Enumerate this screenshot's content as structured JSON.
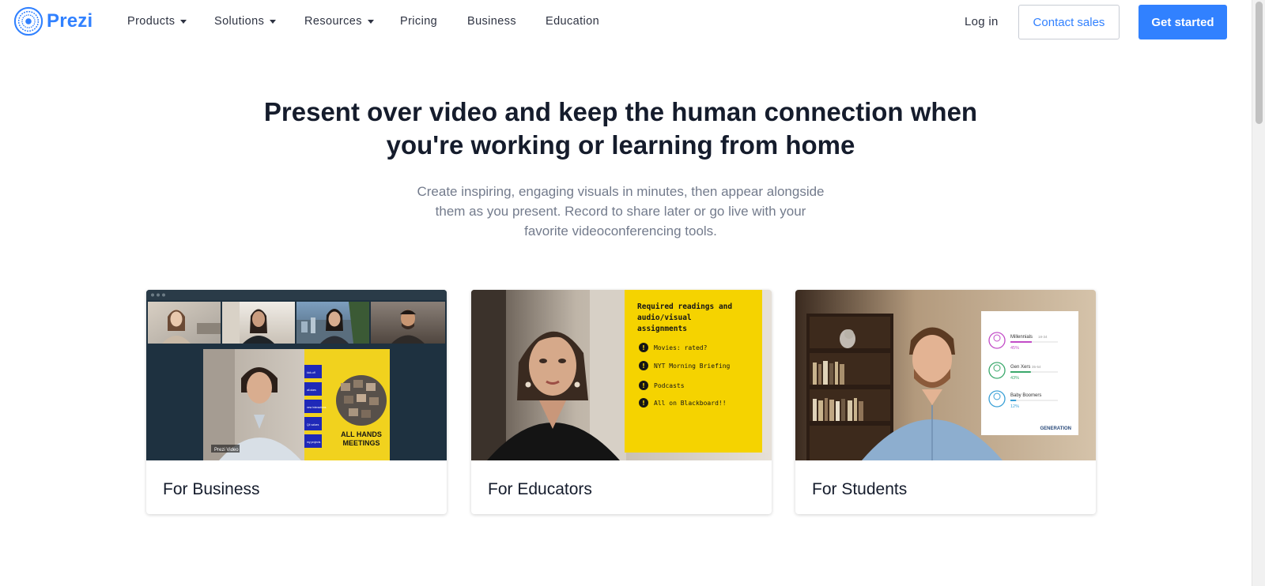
{
  "brand": {
    "name": "Prezi",
    "color": "#3181ff",
    "icon": "prezi-logo-icon"
  },
  "nav": {
    "items": [
      {
        "label": "Products",
        "dropdown": true
      },
      {
        "label": "Solutions",
        "dropdown": true
      },
      {
        "label": "Resources",
        "dropdown": true
      },
      {
        "label": "Pricing",
        "dropdown": false
      },
      {
        "label": "Business",
        "dropdown": false
      },
      {
        "label": "Education",
        "dropdown": false
      }
    ],
    "login": "Log in",
    "contact_sales": "Contact sales",
    "get_started": "Get started"
  },
  "hero": {
    "title_line1": "Present over video and keep the human connection when",
    "title_line2": "you're working or learning from home",
    "subtitle_line1": "Create inspiring, engaging visuals in minutes, then appear alongside",
    "subtitle_line2": "them as you present. Record to share later or go live with your",
    "subtitle_line3": "favorite videoconferencing tools."
  },
  "cards": [
    {
      "label": "For Business",
      "image": {
        "topic_items": [
          "kick-off",
          "all-stars",
          "new interactions",
          "Q4 values",
          "my projects"
        ],
        "headline_line1": "ALL HANDS",
        "headline_line2": "MEETINGS",
        "caption": "Prezi Video"
      }
    },
    {
      "label": "For Educators",
      "image": {
        "heading_line1": "Required readings and",
        "heading_line2": "audio/visual",
        "heading_line3": "assignments",
        "items": [
          "Movies: rated?",
          "NYT Morning Briefing",
          "Podcasts",
          "All on Blackboard!!"
        ]
      }
    },
    {
      "label": "For Students",
      "image": {
        "rows": [
          {
            "name": "Millennials",
            "range": "18-34",
            "percent": "45%",
            "fraction": 0.45,
            "color": "#c24cc7"
          },
          {
            "name": "Gen Xers",
            "range": "35-54",
            "percent": "43%",
            "fraction": 0.43,
            "color": "#3aa86b"
          },
          {
            "name": "Baby Boomers",
            "range": "",
            "percent": "12%",
            "fraction": 0.12,
            "color": "#3aa0d6"
          }
        ],
        "footer": "GENERATION"
      }
    }
  ]
}
